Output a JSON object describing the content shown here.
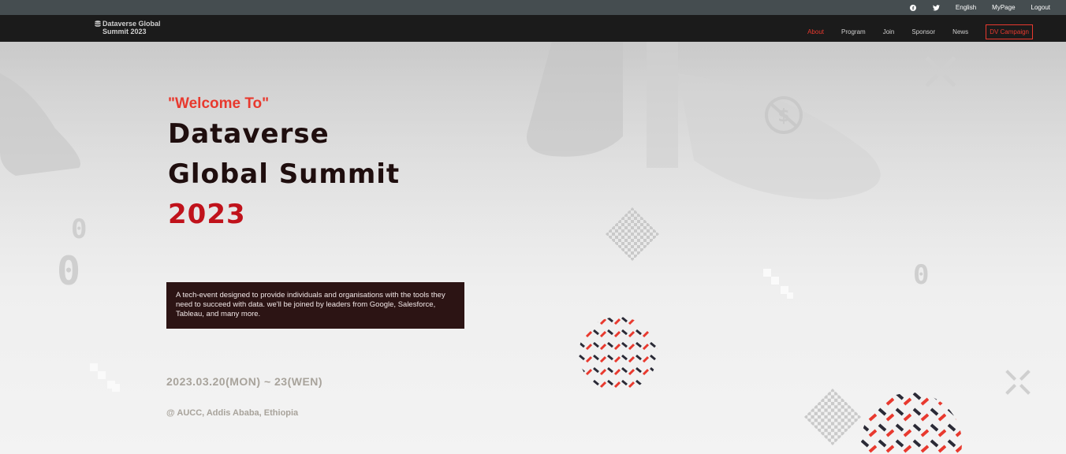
{
  "topbar": {
    "icons": [
      "facebook-icon",
      "twitter-icon"
    ],
    "english_label": "English",
    "mypage_label": "MyPage",
    "logout_label": "Logout"
  },
  "nav": {
    "logo_line1": "Dataverse Global",
    "logo_line2": "Summit 2023",
    "logo_icon": "database-icon",
    "items": [
      {
        "label": "About",
        "active": true
      },
      {
        "label": "Program",
        "active": false
      },
      {
        "label": "Join",
        "active": false
      },
      {
        "label": "Sponsor",
        "active": false
      },
      {
        "label": "News",
        "active": false
      }
    ],
    "campaign_label": "DV Campaign"
  },
  "hero": {
    "welcome": "\"Welcome To\"",
    "title_line1": "Dataverse",
    "title_line2": "Global Summit",
    "title_year": "2023",
    "description": "A tech-event designed to provide individuals and organisations with the tools they need to succeed with data. we'll be joined by leaders from Google, Salesforce, Tableau, and many more.",
    "date": "2023.03.20(MON) ~ 23(WEN)",
    "venue": "@ AUCC, Addis Ababa, Ethiopia",
    "decor_digit": "0"
  },
  "colors": {
    "accent": "#e8392e",
    "topbar_bg": "#454d50",
    "navbar_bg": "#1b1b1b",
    "desc_bg": "#2c1414",
    "title": "#1f0e0e",
    "year": "#c0121b"
  }
}
